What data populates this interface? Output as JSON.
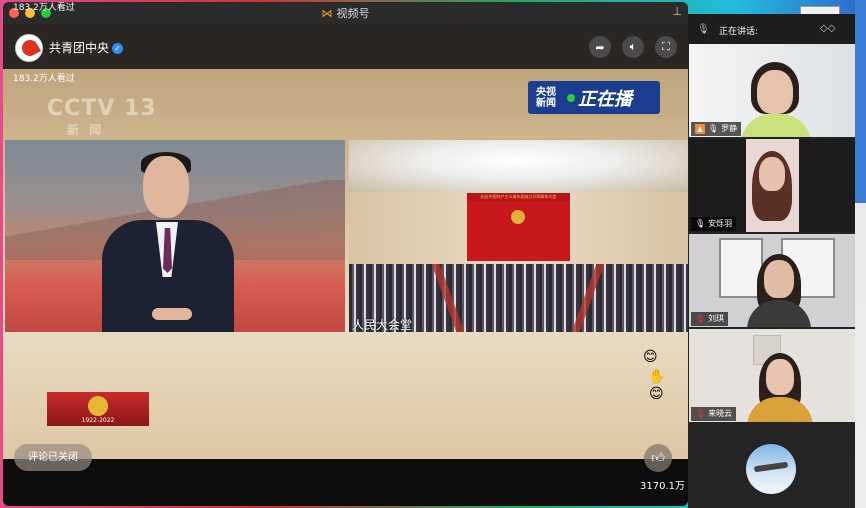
{
  "window": {
    "app_title": "视频号",
    "pin_icon": "pin-icon"
  },
  "channel": {
    "name": "共青团中央",
    "verified": true,
    "viewers": "183.2万人看过"
  },
  "broadcast": {
    "cctv_logo": "CCTV 13",
    "cctv_sub": "新 闻",
    "live_logo_a": "央视\n新闻",
    "live_logo_b": "正在播",
    "venue_label": "人民大会堂",
    "stage_banner": "纪念中国共产主义青年团成立100周年大会",
    "badge_years": "1922-2022"
  },
  "controls": {
    "comments_closed": "评论已关闭",
    "like_count": "3170.1万"
  },
  "meeting": {
    "speaking_label": "正在讲话:",
    "participants": [
      {
        "name": "罗静",
        "host": true,
        "muted": false
      },
      {
        "name": "安烁羽",
        "host": false,
        "muted": false
      },
      {
        "name": "刘琪",
        "host": false,
        "muted": true
      },
      {
        "name": "来晓云",
        "host": false,
        "muted": true
      }
    ]
  },
  "colors": {
    "like": "#ffffff",
    "muted_mic": "#e33333",
    "host_badge": "#f08c3c",
    "live_logo_bg": "#1b3d8f"
  }
}
